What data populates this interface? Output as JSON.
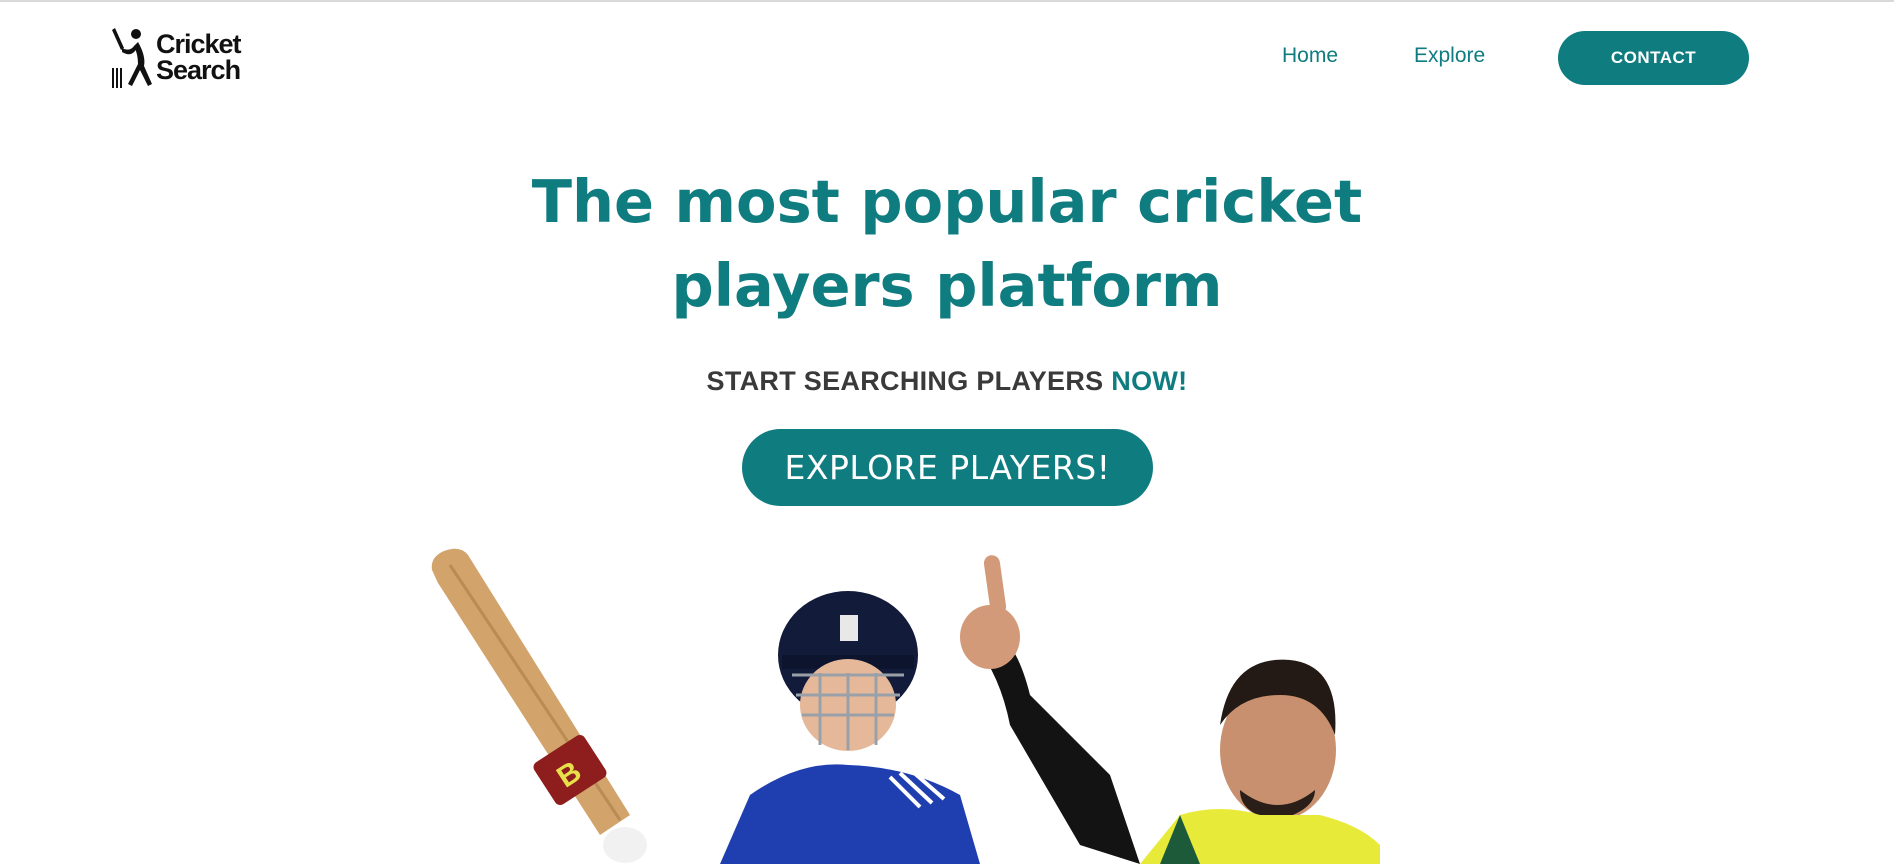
{
  "brand": {
    "logo_line1": "Cricket",
    "logo_line2": "Search"
  },
  "nav": {
    "home": "Home",
    "explore": "Explore",
    "contact": "CONTACT"
  },
  "hero": {
    "title_line1": "The most popular cricket",
    "title_line2": "players platform",
    "subtitle_main": "START SEARCHING PLAYERS ",
    "subtitle_accent": "NOW!",
    "cta": "EXPLORE PLAYERS!"
  },
  "theme": {
    "accent": "#0f7c80",
    "text_dark": "#3a3a3a"
  },
  "icons": {
    "logo": "batsman-wicket-logo"
  }
}
